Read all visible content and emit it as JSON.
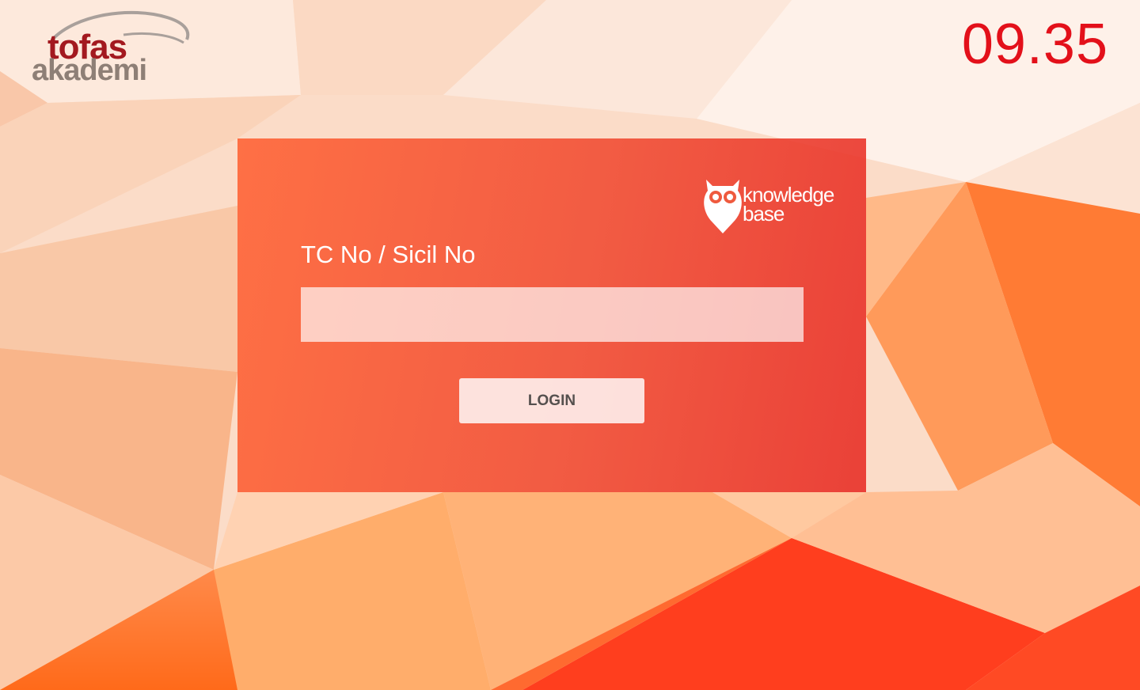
{
  "brand": {
    "logo_line1": "tofas",
    "logo_line2": "akademi",
    "logo_colors": {
      "primary": "#a3191f",
      "secondary": "#8e7f76"
    }
  },
  "clock": {
    "time": "09.35",
    "color": "#e3101a"
  },
  "login_panel": {
    "badge": {
      "icon": "owl-icon",
      "line1": "knowledge",
      "line2": "base"
    },
    "field_label": "TC No / Sicil No",
    "field_value": "",
    "field_placeholder": "",
    "login_label": "LOGIN",
    "accent": "#f2553a"
  }
}
